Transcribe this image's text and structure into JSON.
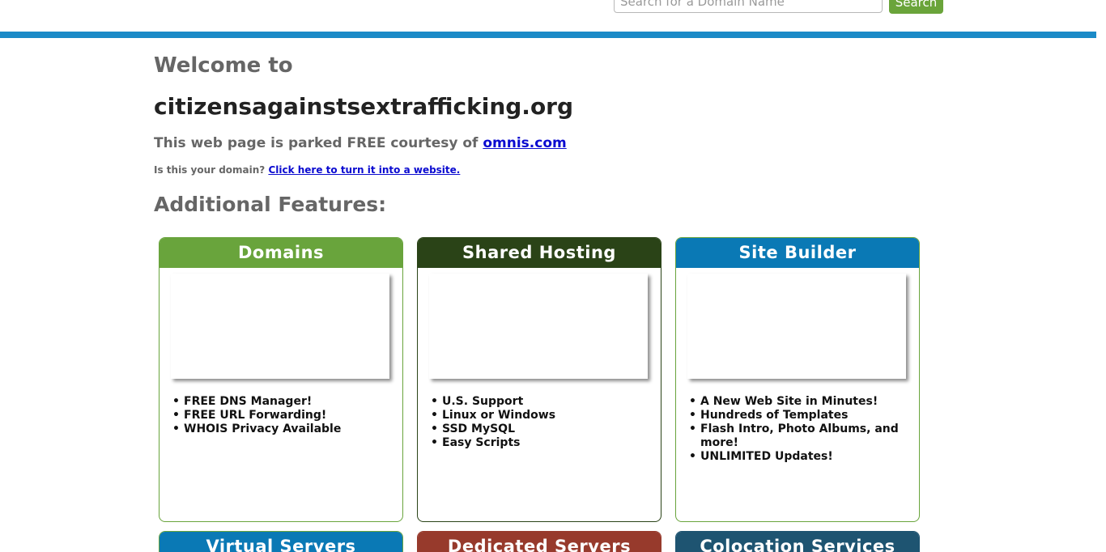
{
  "search": {
    "placeholder": "Search for a Domain Name",
    "button_label": "Search"
  },
  "colors": {
    "rule": "#1b8ac7",
    "search_button": "#6aa43a",
    "link": "#0a0ad0",
    "card_border": "#69a43c"
  },
  "heading": {
    "welcome": "Welcome to",
    "domain": "citizensagainstsextrafficking.org",
    "parked_text": "This web page is parked FREE courtesy of ",
    "parked_link": "omnis.com",
    "question": "Is this your domain? ",
    "question_link": "Click here to turn it into a website.",
    "features": "Additional Features:"
  },
  "cards": [
    {
      "title": "Domains",
      "color": "#69a43c",
      "items": [
        "FREE DNS Manager!",
        "FREE URL Forwarding!",
        "WHOIS Privacy Available"
      ]
    },
    {
      "title": "Shared Hosting",
      "color": "#2a4317",
      "items": [
        "U.S. Support",
        "Linux or Windows",
        "SSD MySQL",
        "Easy Scripts"
      ]
    },
    {
      "title": "Site Builder",
      "color": "#0a79b5",
      "items": [
        "A New Web Site in Minutes!",
        "Hundreds of Templates",
        "Flash Intro, Photo Albums, and more!",
        "UNLIMITED Updates!"
      ]
    },
    {
      "title": "Virtual Servers",
      "color": "#0a79b5",
      "items": []
    },
    {
      "title": "Dedicated Servers",
      "color": "#973a2c",
      "items": []
    },
    {
      "title": "Colocation Services",
      "color": "#1e5471",
      "items": []
    }
  ]
}
